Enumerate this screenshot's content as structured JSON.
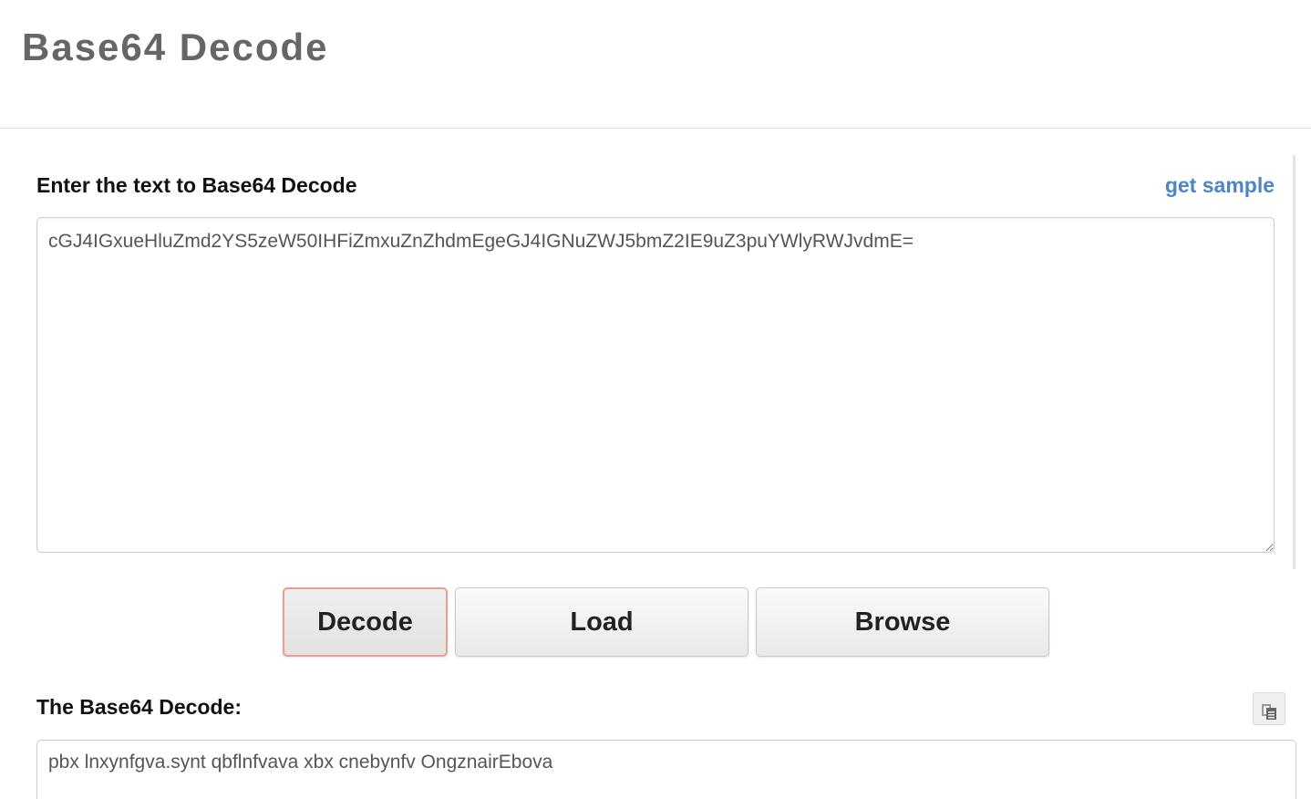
{
  "header": {
    "title": "Base64 Decode"
  },
  "input_section": {
    "label": "Enter the text to Base64 Decode",
    "get_sample_link": "get sample",
    "input_value": "cGJ4IGxueHluZmd2YS5zeW50IHFiZmxuZnZhdmEgeGJ4IGNuZWJ5bmZ2IE9uZ3puYWlyRWJvdmE="
  },
  "buttons": {
    "decode": "Decode",
    "load": "Load",
    "browse": "Browse"
  },
  "output_section": {
    "label": "The Base64 Decode:",
    "copy_icon": "copy-icon",
    "output_value": "pbx lnxynfgva.synt qbflnfvava xbx cnebynfv OngznairEbova"
  },
  "colors": {
    "title": "#666666",
    "link": "#4a86c8",
    "decode_focus_border": "#e8a08c"
  }
}
